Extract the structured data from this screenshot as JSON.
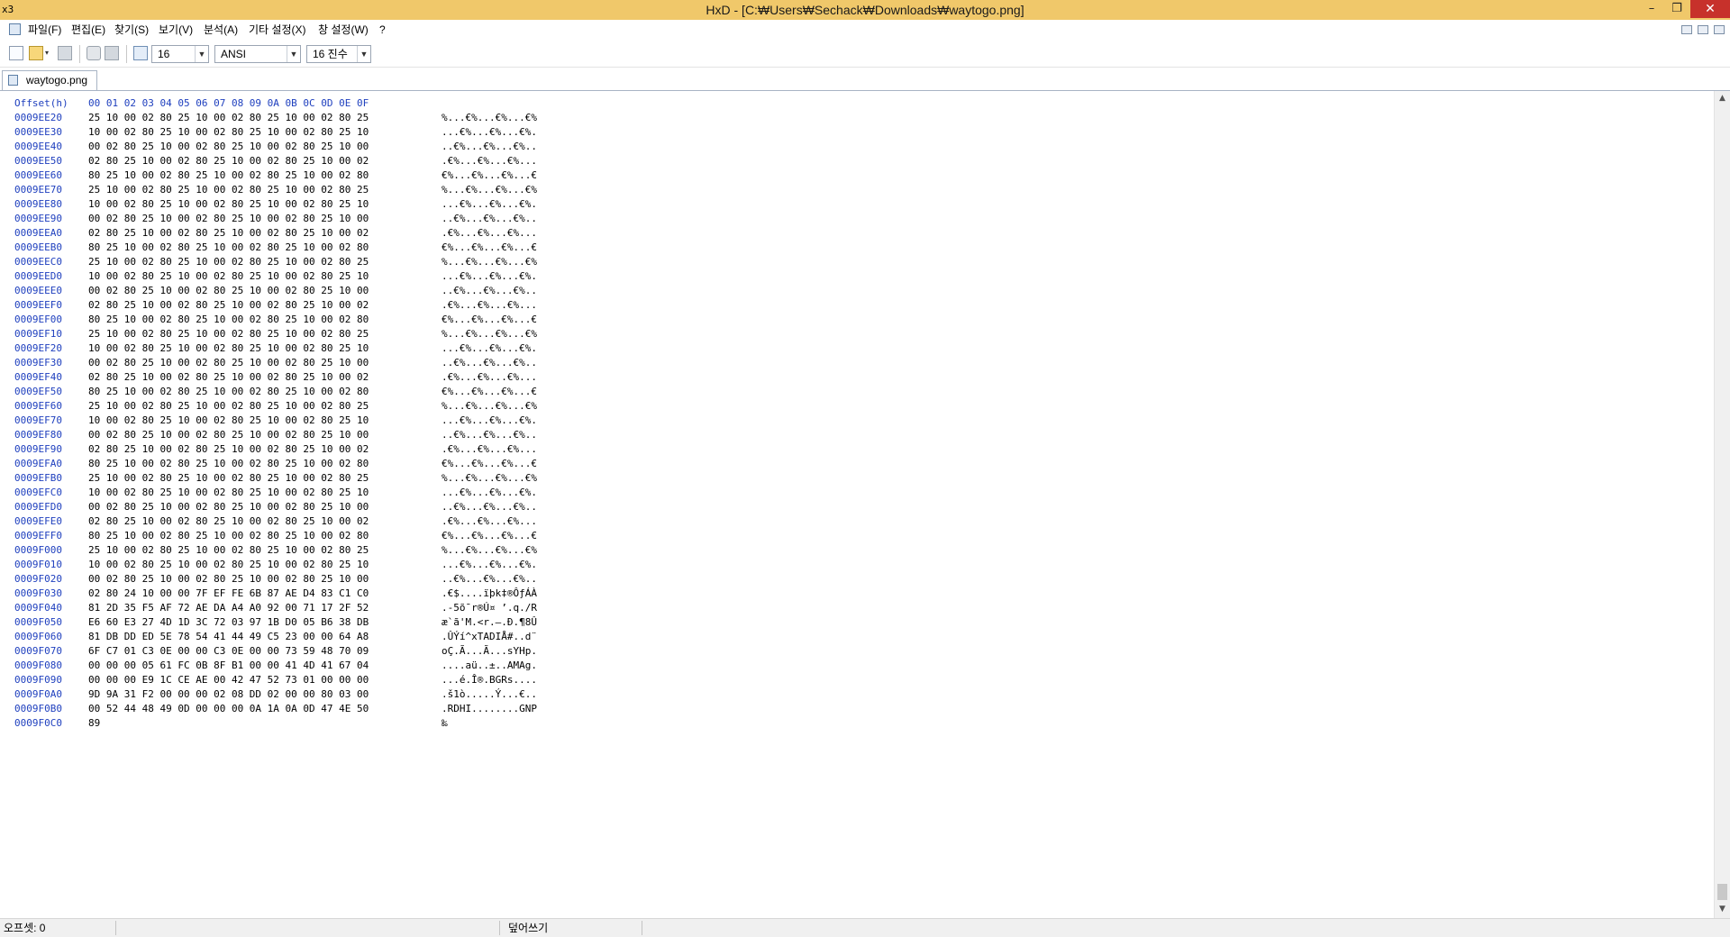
{
  "window": {
    "title": "HxD - [C:₩Users₩Sechack₩Downloads₩waytogo.png]",
    "min_glyph": "–",
    "max_glyph": "❐",
    "close_glyph": "✕",
    "app_icon_glyph": "x3"
  },
  "menu": {
    "items": [
      "파일(F)",
      "편집(E)",
      "찾기(S)",
      "보기(V)",
      "분석(A)",
      "기타 설정(X)",
      "창 설정(W)",
      "?"
    ]
  },
  "toolbar": {
    "bytes_per_row": "16",
    "charset": "ANSI",
    "offset_base": "16 진수"
  },
  "tabs": [
    {
      "label": "waytogo.png"
    }
  ],
  "hex_view": {
    "offset_header": "Offset(h)",
    "column_header": "00 01 02 03 04 05 06 07 08 09 0A 0B 0C 0D 0E 0F",
    "rows": [
      {
        "offset": "0009EE20",
        "hex": "25 10 00 02 80 25 10 00 02 80 25 10 00 02 80 25",
        "text": "%...€%...€%...€%"
      },
      {
        "offset": "0009EE30",
        "hex": "10 00 02 80 25 10 00 02 80 25 10 00 02 80 25 10",
        "text": "...€%...€%...€%."
      },
      {
        "offset": "0009EE40",
        "hex": "00 02 80 25 10 00 02 80 25 10 00 02 80 25 10 00",
        "text": "..€%...€%...€%.."
      },
      {
        "offset": "0009EE50",
        "hex": "02 80 25 10 00 02 80 25 10 00 02 80 25 10 00 02",
        "text": ".€%...€%...€%..."
      },
      {
        "offset": "0009EE60",
        "hex": "80 25 10 00 02 80 25 10 00 02 80 25 10 00 02 80",
        "text": "€%...€%...€%...€"
      },
      {
        "offset": "0009EE70",
        "hex": "25 10 00 02 80 25 10 00 02 80 25 10 00 02 80 25",
        "text": "%...€%...€%...€%"
      },
      {
        "offset": "0009EE80",
        "hex": "10 00 02 80 25 10 00 02 80 25 10 00 02 80 25 10",
        "text": "...€%...€%...€%."
      },
      {
        "offset": "0009EE90",
        "hex": "00 02 80 25 10 00 02 80 25 10 00 02 80 25 10 00",
        "text": "..€%...€%...€%.."
      },
      {
        "offset": "0009EEA0",
        "hex": "02 80 25 10 00 02 80 25 10 00 02 80 25 10 00 02",
        "text": ".€%...€%...€%..."
      },
      {
        "offset": "0009EEB0",
        "hex": "80 25 10 00 02 80 25 10 00 02 80 25 10 00 02 80",
        "text": "€%...€%...€%...€"
      },
      {
        "offset": "0009EEC0",
        "hex": "25 10 00 02 80 25 10 00 02 80 25 10 00 02 80 25",
        "text": "%...€%...€%...€%"
      },
      {
        "offset": "0009EED0",
        "hex": "10 00 02 80 25 10 00 02 80 25 10 00 02 80 25 10",
        "text": "...€%...€%...€%."
      },
      {
        "offset": "0009EEE0",
        "hex": "00 02 80 25 10 00 02 80 25 10 00 02 80 25 10 00",
        "text": "..€%...€%...€%.."
      },
      {
        "offset": "0009EEF0",
        "hex": "02 80 25 10 00 02 80 25 10 00 02 80 25 10 00 02",
        "text": ".€%...€%...€%..."
      },
      {
        "offset": "0009EF00",
        "hex": "80 25 10 00 02 80 25 10 00 02 80 25 10 00 02 80",
        "text": "€%...€%...€%...€"
      },
      {
        "offset": "0009EF10",
        "hex": "25 10 00 02 80 25 10 00 02 80 25 10 00 02 80 25",
        "text": "%...€%...€%...€%"
      },
      {
        "offset": "0009EF20",
        "hex": "10 00 02 80 25 10 00 02 80 25 10 00 02 80 25 10",
        "text": "...€%...€%...€%."
      },
      {
        "offset": "0009EF30",
        "hex": "00 02 80 25 10 00 02 80 25 10 00 02 80 25 10 00",
        "text": "..€%...€%...€%.."
      },
      {
        "offset": "0009EF40",
        "hex": "02 80 25 10 00 02 80 25 10 00 02 80 25 10 00 02",
        "text": ".€%...€%...€%..."
      },
      {
        "offset": "0009EF50",
        "hex": "80 25 10 00 02 80 25 10 00 02 80 25 10 00 02 80",
        "text": "€%...€%...€%...€"
      },
      {
        "offset": "0009EF60",
        "hex": "25 10 00 02 80 25 10 00 02 80 25 10 00 02 80 25",
        "text": "%...€%...€%...€%"
      },
      {
        "offset": "0009EF70",
        "hex": "10 00 02 80 25 10 00 02 80 25 10 00 02 80 25 10",
        "text": "...€%...€%...€%."
      },
      {
        "offset": "0009EF80",
        "hex": "00 02 80 25 10 00 02 80 25 10 00 02 80 25 10 00",
        "text": "..€%...€%...€%.."
      },
      {
        "offset": "0009EF90",
        "hex": "02 80 25 10 00 02 80 25 10 00 02 80 25 10 00 02",
        "text": ".€%...€%...€%..."
      },
      {
        "offset": "0009EFA0",
        "hex": "80 25 10 00 02 80 25 10 00 02 80 25 10 00 02 80",
        "text": "€%...€%...€%...€"
      },
      {
        "offset": "0009EFB0",
        "hex": "25 10 00 02 80 25 10 00 02 80 25 10 00 02 80 25",
        "text": "%...€%...€%...€%"
      },
      {
        "offset": "0009EFC0",
        "hex": "10 00 02 80 25 10 00 02 80 25 10 00 02 80 25 10",
        "text": "...€%...€%...€%."
      },
      {
        "offset": "0009EFD0",
        "hex": "00 02 80 25 10 00 02 80 25 10 00 02 80 25 10 00",
        "text": "..€%...€%...€%.."
      },
      {
        "offset": "0009EFE0",
        "hex": "02 80 25 10 00 02 80 25 10 00 02 80 25 10 00 02",
        "text": ".€%...€%...€%..."
      },
      {
        "offset": "0009EFF0",
        "hex": "80 25 10 00 02 80 25 10 00 02 80 25 10 00 02 80",
        "text": "€%...€%...€%...€"
      },
      {
        "offset": "0009F000",
        "hex": "25 10 00 02 80 25 10 00 02 80 25 10 00 02 80 25",
        "text": "%...€%...€%...€%"
      },
      {
        "offset": "0009F010",
        "hex": "10 00 02 80 25 10 00 02 80 25 10 00 02 80 25 10",
        "text": "...€%...€%...€%."
      },
      {
        "offset": "0009F020",
        "hex": "00 02 80 25 10 00 02 80 25 10 00 02 80 25 10 00",
        "text": "..€%...€%...€%.."
      },
      {
        "offset": "0009F030",
        "hex": "02 80 24 10 00 00 7F EF FE 6B 87 AE D4 83 C1 C0",
        "text": ".€$....ïþk‡®ÔƒÁÀ"
      },
      {
        "offset": "0009F040",
        "hex": "81 2D 35 F5 AF 72 AE DA A4 A0 92 00 71 17 2F 52",
        "text": ".-5õ¯r®Ú¤ ’.q./R"
      },
      {
        "offset": "0009F050",
        "hex": "E6 60 E3 27 4D 1D 3C 72 03 97 1B D0 05 B6 38 DB",
        "text": "æ`ã'M.<r.—.Ð.¶8Û"
      },
      {
        "offset": "0009F060",
        "hex": "81 DB DD ED 5E 78 54 41 44 49 C5 23 00 00 64 A8",
        "text": ".ÛÝí^xTADIÅ#..d¨"
      },
      {
        "offset": "0009F070",
        "hex": "6F C7 01 C3 0E 00 00 C3 0E 00 00 73 59 48 70 09",
        "text": "oÇ.Ã...Ã...sYHp."
      },
      {
        "offset": "0009F080",
        "hex": "00 00 00 05 61 FC 0B 8F B1 00 00 41 4D 41 67 04",
        "text": "....aü..±..AMAg."
      },
      {
        "offset": "0009F090",
        "hex": "00 00 00 E9 1C CE AE 00 42 47 52 73 01 00 00 00",
        "text": "...é.Î®.BGRs...."
      },
      {
        "offset": "0009F0A0",
        "hex": "9D 9A 31 F2 00 00 00 02 08 DD 02 00 00 80 03 00",
        "text": ".š1ò.....Ý...€.."
      },
      {
        "offset": "0009F0B0",
        "hex": "00 52 44 48 49 0D 00 00 00 0A 1A 0A 0D 47 4E 50",
        "text": ".RDHI........GNP"
      },
      {
        "offset": "0009F0C0",
        "hex": "89",
        "text": "‰"
      }
    ]
  },
  "statusbar": {
    "offset_label": "오프셋: 0",
    "mode_label": "덮어쓰기"
  }
}
